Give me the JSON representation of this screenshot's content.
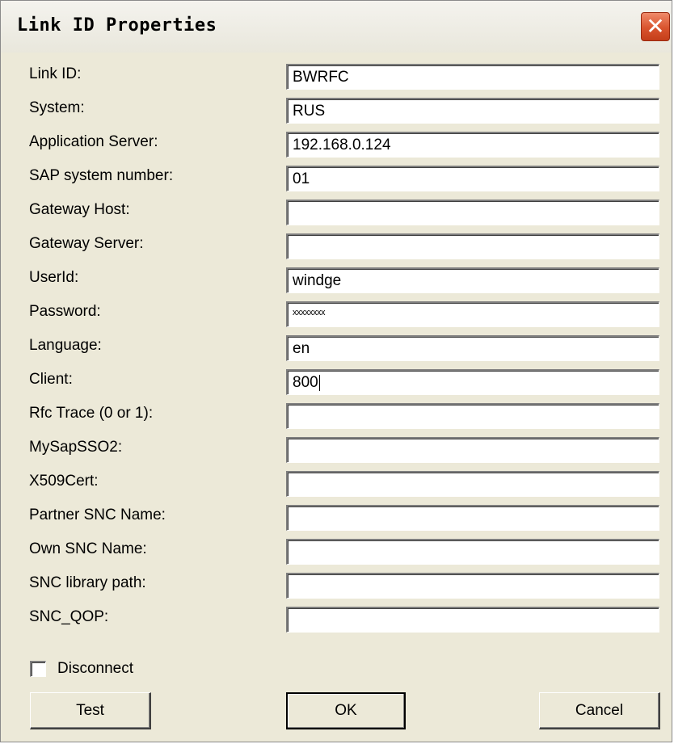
{
  "window": {
    "title": "Link ID Properties",
    "close_glyph": "✕"
  },
  "fields": [
    {
      "label": "Link ID:",
      "value": "BWRFC"
    },
    {
      "label": "System:",
      "value": "RUS"
    },
    {
      "label": "Application Server:",
      "value": "192.168.0.124"
    },
    {
      "label": "SAP system number:",
      "value": "01"
    },
    {
      "label": "Gateway Host:",
      "value": ""
    },
    {
      "label": "Gateway Server:",
      "value": ""
    },
    {
      "label": "UserId:",
      "value": "windge"
    },
    {
      "label": "Password:",
      "value": "xxxxxxxx"
    },
    {
      "label": "Language:",
      "value": "en"
    },
    {
      "label": "Client:",
      "value": "800"
    },
    {
      "label": "Rfc Trace (0 or 1):",
      "value": ""
    },
    {
      "label": "MySapSSO2:",
      "value": ""
    },
    {
      "label": "X509Cert:",
      "value": ""
    },
    {
      "label": "Partner SNC Name:",
      "value": ""
    },
    {
      "label": "Own SNC Name:",
      "value": ""
    },
    {
      "label": "SNC library path:",
      "value": ""
    },
    {
      "label": "SNC_QOP:",
      "value": ""
    }
  ],
  "disconnect": {
    "label": "Disconnect",
    "checked": false
  },
  "buttons": {
    "test": "Test",
    "ok": "OK",
    "cancel": "Cancel"
  },
  "colors": {
    "dialog_bg": "#ece9d8",
    "close_button": "#d9542e"
  }
}
